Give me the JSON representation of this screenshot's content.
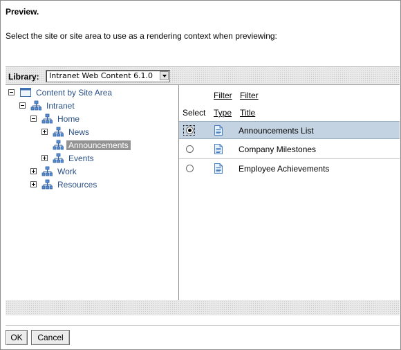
{
  "dialog": {
    "title": "Preview.",
    "instruction": "Select the site or site area to use as a rendering context when previewing:"
  },
  "library": {
    "label": "Library:",
    "selected": "Intranet Web Content 6.1.0"
  },
  "tree": {
    "root": "Content by Site Area",
    "intranet": "Intranet",
    "home": "Home",
    "news": "News",
    "announcements": "Announcements",
    "events": "Events",
    "work": "Work",
    "resources": "Resources"
  },
  "table": {
    "filter_type": "Filter",
    "filter_title": "Filter",
    "col_select": "Select",
    "col_type": "Type",
    "col_title": "Title",
    "rows": [
      {
        "title": "Announcements List",
        "selected": true
      },
      {
        "title": "Company Milestones",
        "selected": false
      },
      {
        "title": "Employee Achievements",
        "selected": false
      }
    ]
  },
  "buttons": {
    "ok": "OK",
    "cancel": "Cancel"
  },
  "colors": {
    "link_blue": "#2a4f84",
    "selected_row": "#c4d3e2",
    "tree_selection": "#939393"
  },
  "icons": {
    "site": "sitemap-icon",
    "content_root": "window-icon",
    "document": "document-icon"
  }
}
